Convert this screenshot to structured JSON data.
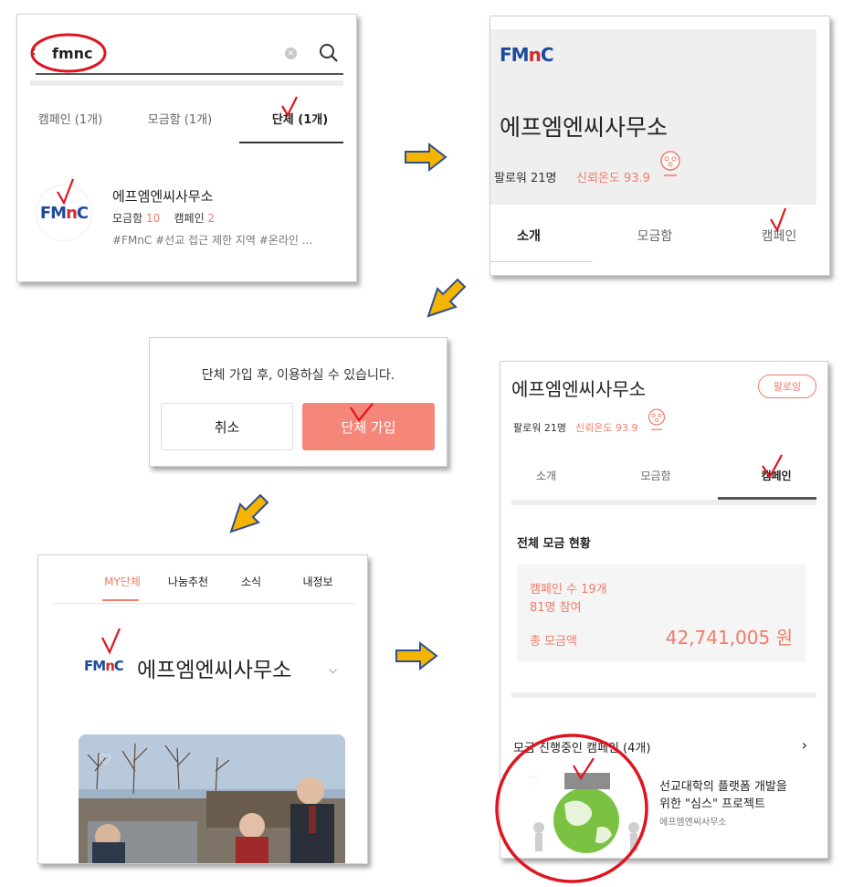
{
  "panel1": {
    "search_value": "fmnc",
    "tabs": [
      "캠페인 (1개)",
      "모금함 (1개)",
      "단체 (1개)"
    ],
    "result": {
      "logo": "FMnC",
      "name": "에프엠엔씨사무소",
      "stat1_label": "모금함",
      "stat1_value": "10",
      "stat2_label": "캠페인",
      "stat2_value": "2",
      "tags": "#FMnC #선교 접근 제한 지역 #온라인 ..."
    }
  },
  "panel2": {
    "logo": "FMnC",
    "org_name": "에프엠엔씨사무소",
    "followers": "팔로워 21명",
    "trust": "신뢰온도 93.9",
    "tabs": [
      "소개",
      "모금함",
      "캠페인"
    ]
  },
  "panel3": {
    "message": "단체 가입 후, 이용하실 수 있습니다.",
    "cancel_label": "취소",
    "join_label": "단체 가입"
  },
  "panel4": {
    "tabs": [
      "MY단체",
      "나눔추천",
      "소식",
      "내정보"
    ],
    "logo": "FMnC",
    "org_name": "에프엠엔씨사무소"
  },
  "panel5": {
    "org_name": "에프엠엔씨사무소",
    "follow_label": "팔로잉",
    "followers": "팔로워 21명",
    "trust": "신뢰온도 93.9",
    "tabs": [
      "소개",
      "모금함",
      "캠페인"
    ],
    "section_title": "전체 모금 현황",
    "campaign_count": "캠페인 수 19개",
    "participants": "81명 참여",
    "total_label": "총 모금액",
    "total_value": "42,741,005 원",
    "ongoing_title": "모금 진행중인 캠페인 (4개)",
    "campaign_title_line1": "선교대학의 플랫폼 개발을",
    "campaign_title_line2": "위한 \"심스\" 프로젝트",
    "campaign_org": "에프엠엔씨사무소"
  },
  "colors": {
    "accent": "#f07c6a",
    "join_button": "#f4877a",
    "arrow_fill": "#f5b400",
    "arrow_stroke": "#2e4f8f",
    "annotation_red": "#e0141e",
    "logo_blue": "#1c4a9c"
  }
}
